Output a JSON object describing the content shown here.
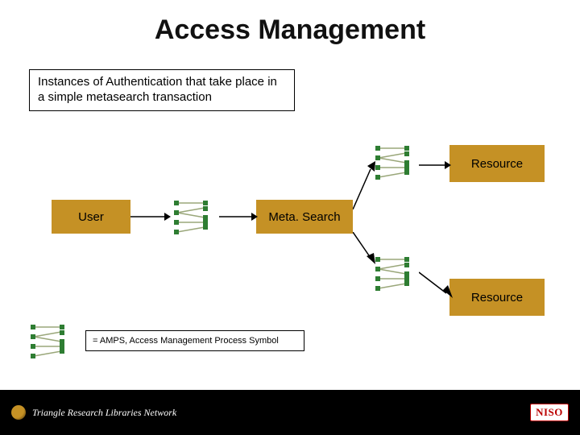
{
  "title": "Access Management",
  "caption": "Instances of Authentication that take place in a simple metasearch transaction",
  "nodes": {
    "user": "User",
    "meta": "Meta. Search",
    "resource1": "Resource",
    "resource2": "Resource"
  },
  "legend": "= AMPS, Access Management Process Symbol",
  "colors": {
    "nodeFill": "#c59125",
    "ampsDot": "#2e7d32",
    "ampsLine": "#9aa77a",
    "footer": "#000000"
  },
  "footer": {
    "trln": "Triangle Research Libraries Network",
    "niso": "NISO"
  }
}
